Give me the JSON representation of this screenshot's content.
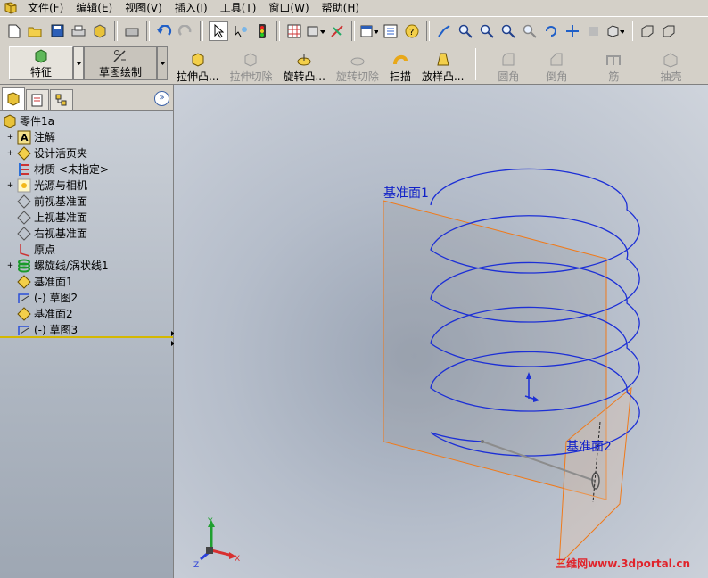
{
  "menu": [
    "文件(F)",
    "编辑(E)",
    "视图(V)",
    "插入(I)",
    "工具(T)",
    "窗口(W)",
    "帮助(H)"
  ],
  "commands": {
    "feature_tab": "特征",
    "sketch_tab": "草图绘制",
    "items": [
      {
        "label": "拉伸凸...",
        "enabled": true
      },
      {
        "label": "拉伸切除",
        "enabled": false
      },
      {
        "label": "旋转凸...",
        "enabled": true
      },
      {
        "label": "旋转切除",
        "enabled": false
      },
      {
        "label": "扫描",
        "enabled": true
      },
      {
        "label": "放样凸...",
        "enabled": true
      },
      {
        "label": "圆角",
        "enabled": false
      },
      {
        "label": "倒角",
        "enabled": false
      },
      {
        "label": "筋",
        "enabled": false
      },
      {
        "label": "抽壳",
        "enabled": false
      }
    ]
  },
  "tree": {
    "root": "零件1a",
    "items": [
      {
        "label": "注解",
        "icon": "annotation-icon",
        "expandable": true
      },
      {
        "label": "设计活页夹",
        "icon": "binder-icon",
        "expandable": true
      },
      {
        "label": "材质 <未指定>",
        "icon": "material-icon",
        "expandable": false
      },
      {
        "label": "光源与相机",
        "icon": "light-icon",
        "expandable": true
      },
      {
        "label": "前视基准面",
        "icon": "plane-icon",
        "expandable": false
      },
      {
        "label": "上视基准面",
        "icon": "plane-icon",
        "expandable": false
      },
      {
        "label": "右视基准面",
        "icon": "plane-icon",
        "expandable": false
      },
      {
        "label": "原点",
        "icon": "origin-icon",
        "expandable": false
      },
      {
        "label": "螺旋线/涡状线1",
        "icon": "helix-icon",
        "expandable": true
      },
      {
        "label": "基准面1",
        "icon": "plane-yellow-icon",
        "expandable": false
      },
      {
        "label": "(-) 草图2",
        "icon": "sketch-icon",
        "expandable": false
      },
      {
        "label": "基准面2",
        "icon": "plane-yellow-icon",
        "expandable": false
      },
      {
        "label": "(-) 草图3",
        "icon": "sketch-icon",
        "expandable": false
      }
    ]
  },
  "viewport": {
    "plane1_label": "基准面1",
    "plane2_label": "基准面2",
    "triad": {
      "x": "X",
      "y": "Y",
      "z": "Z"
    },
    "watermark": "三维网www.3dportal.cn",
    "colors": {
      "helix": "#1c2fd6",
      "plane": "#f07a1a",
      "label": "#1020c8"
    }
  }
}
